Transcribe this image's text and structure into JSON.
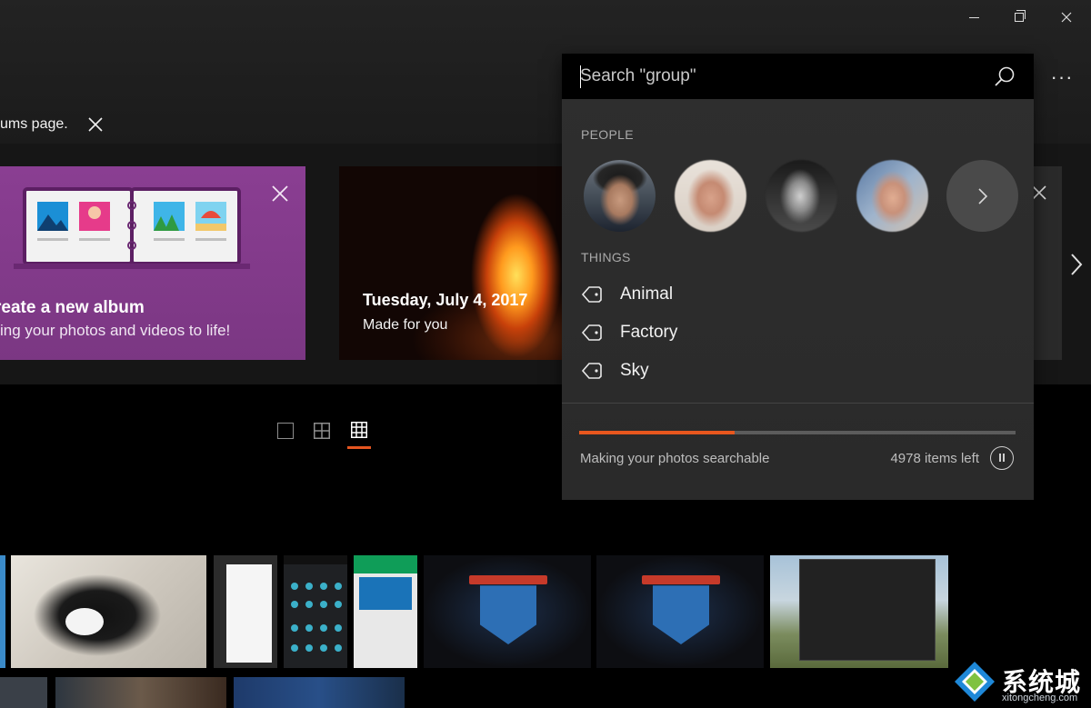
{
  "window": {
    "minimize": "minimize",
    "maximize": "maximize",
    "close": "close"
  },
  "header": {
    "more_label": "···"
  },
  "notice": {
    "text": "ums page."
  },
  "carousel": {
    "album_card": {
      "title": "reate a new album",
      "subtitle": "ing your photos and videos to life!"
    },
    "memory_card": {
      "title": "Tuesday, July 4, 2017",
      "subtitle": "Made for you"
    }
  },
  "view_toggle": {
    "selected": "small-grid"
  },
  "search": {
    "placeholder": "Search \"group\"",
    "people_label": "PEOPLE",
    "things_label": "THINGS",
    "things": [
      {
        "label": "Animal",
        "icon": "tag-icon"
      },
      {
        "label": "Factory",
        "icon": "tag-icon"
      },
      {
        "label": "Sky",
        "icon": "tag-icon"
      }
    ],
    "progress": {
      "fraction": 0.357,
      "status": "Making your photos searchable",
      "items_left": "4978 items left"
    }
  },
  "colors": {
    "accent": "#e8571e",
    "panel": "#2c2c2c",
    "album_card": "#8a3e92"
  },
  "watermark": {
    "text": "系统城",
    "url": "xitongcheng.com"
  }
}
